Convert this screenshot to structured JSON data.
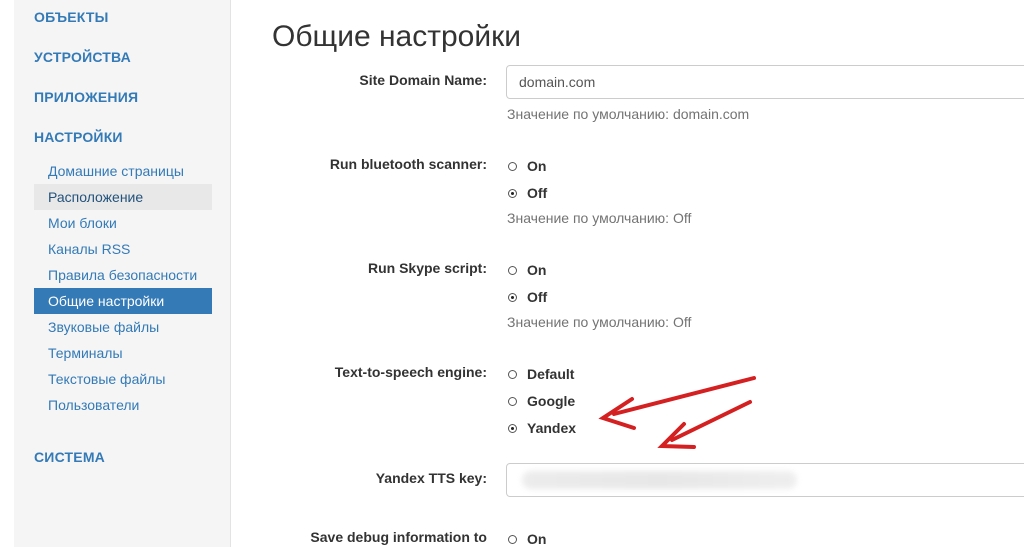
{
  "sidebar": {
    "sections": [
      {
        "label": "ОБЪЕКТЫ"
      },
      {
        "label": "УСТРОЙСТВА"
      },
      {
        "label": "ПРИЛОЖЕНИЯ"
      },
      {
        "label": "НАСТРОЙКИ"
      },
      {
        "label": "СИСТЕМА"
      }
    ],
    "settings_items": [
      {
        "label": "Домашние страницы"
      },
      {
        "label": "Расположение"
      },
      {
        "label": "Мои блоки"
      },
      {
        "label": "Каналы RSS"
      },
      {
        "label": "Правила безопасности"
      },
      {
        "label": "Общие настройки"
      },
      {
        "label": "Звуковые файлы"
      },
      {
        "label": "Терминалы"
      },
      {
        "label": "Текстовые файлы"
      },
      {
        "label": "Пользователи"
      }
    ],
    "hover_item": "Расположение",
    "active_item": "Общие настройки"
  },
  "page": {
    "title": "Общие настройки"
  },
  "settings": {
    "domain": {
      "label": "Site Domain Name:",
      "value": "domain.com",
      "default_text": "Значение по умолчанию: domain.com"
    },
    "bluetooth": {
      "label": "Run bluetooth scanner:",
      "options": [
        "On",
        "Off"
      ],
      "selected": "Off",
      "default_text": "Значение по умолчанию: Off"
    },
    "skype": {
      "label": "Run Skype script:",
      "options": [
        "On",
        "Off"
      ],
      "selected": "Off",
      "default_text": "Значение по умолчанию: Off"
    },
    "tts_engine": {
      "label": "Text-to-speech engine:",
      "options": [
        "Default",
        "Google",
        "Yandex"
      ],
      "selected": "Yandex"
    },
    "yandex_key": {
      "label": "Yandex TTS key:",
      "value": ""
    },
    "debug": {
      "label": "Save debug information to",
      "options": [
        "On"
      ]
    }
  },
  "annotation_color": "#d42020"
}
